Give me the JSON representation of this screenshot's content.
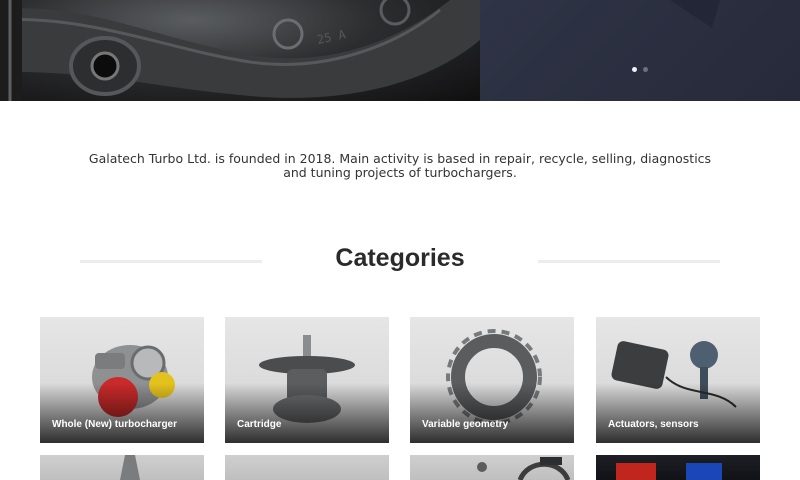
{
  "hero": {
    "slider_dots": [
      {
        "active": true
      },
      {
        "active": false
      }
    ]
  },
  "about": {
    "text": "Galatech Turbo Ltd. is founded in 2018. Main activity is based in repair, recycle, selling, diagnostics and tuning projects of turbochargers."
  },
  "categories": {
    "title": "Categories",
    "items": [
      {
        "label": "Whole (New) turbocharger"
      },
      {
        "label": "Cartridge"
      },
      {
        "label": "Variable geometry"
      },
      {
        "label": "Actuators, sensors"
      }
    ]
  },
  "colors": {
    "accent_text": "#2a2a2a",
    "body_text": "#333333",
    "divider": "#ececec"
  }
}
